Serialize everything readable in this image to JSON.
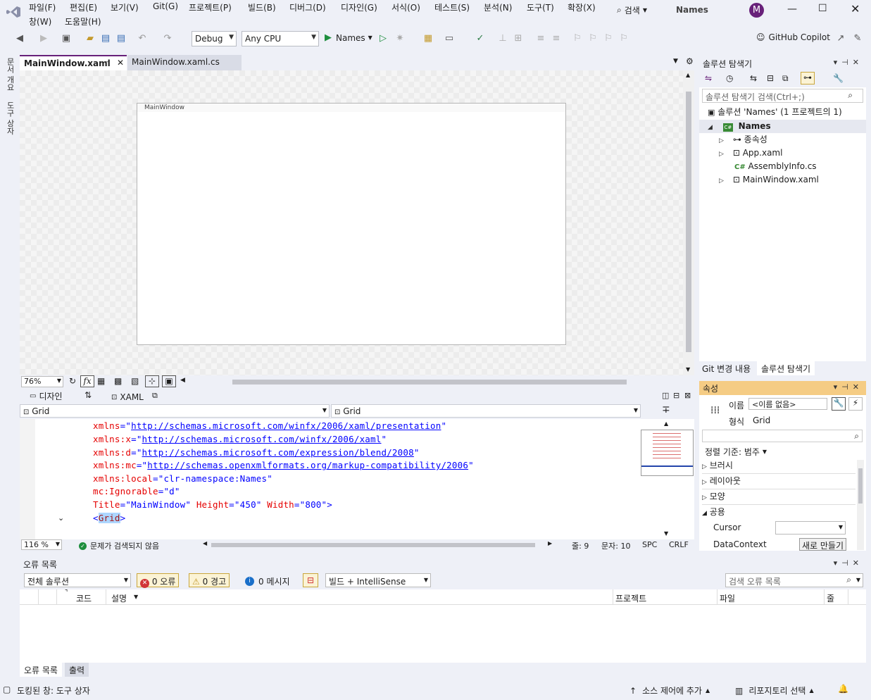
{
  "menu": {
    "row1": [
      "파일(F)",
      "편집(E)",
      "보기(V)",
      "Git(G)",
      "프로젝트(P)",
      "빌드(B)",
      "디버그(D)",
      "디자인(G)",
      "서식(O)",
      "테스트(S)",
      "분석(N)",
      "도구(T)",
      "확장(X)"
    ],
    "row2": [
      "창(W)",
      "도움말(H)"
    ],
    "search_label": "검색",
    "solution_name": "Names",
    "avatar_letter": "M"
  },
  "toolbar": {
    "config": "Debug",
    "platform": "Any CPU",
    "run_target": "Names",
    "copilot": "GitHub Copilot"
  },
  "leftrail": {
    "item1": "문서 개요",
    "item2": "도구 상자"
  },
  "doctabs": {
    "tab1": "MainWindow.xaml",
    "tab2": "MainWindow.xaml.cs"
  },
  "designer": {
    "window_title": "MainWindow"
  },
  "zoom": {
    "designer_zoom": "76%",
    "fx": "fx"
  },
  "split": {
    "design_tab": "디자인",
    "swap": "⇅",
    "xaml_tab": "XAML"
  },
  "elembar": {
    "left": "Grid",
    "right": "Grid"
  },
  "code": {
    "line1": {
      "attr": "xmlns",
      "url": "http://schemas.microsoft.com/winfx/2006/xaml/presentation"
    },
    "line2": {
      "attr": "xmlns:x",
      "url": "http://schemas.microsoft.com/winfx/2006/xaml"
    },
    "line3": {
      "attr": "xmlns:d",
      "url": "http://schemas.microsoft.com/expression/blend/2008"
    },
    "line4": {
      "attr": "xmlns:mc",
      "url": "http://schemas.openxmlformats.org/markup-compatibility/2006"
    },
    "line5": {
      "attr": "xmlns:local",
      "val": "clr-namespace:Names"
    },
    "line6": {
      "attr": "mc:Ignorable",
      "val": "d"
    },
    "line7": {
      "a1": "Title",
      "v1": "MainWindow",
      "a2": "Height",
      "v2": "450",
      "a3": "Width",
      "v3": "800"
    },
    "line8": {
      "tag": "Grid"
    }
  },
  "editor_status": {
    "zoom": "116 %",
    "issues": "문제가 검색되지 않음",
    "line": "줄: 9",
    "col": "문자: 10",
    "spc": "SPC",
    "crlf": "CRLF"
  },
  "solution": {
    "title": "솔루션 탐색기",
    "search_placeholder": "솔루션 탐색기 검색(Ctrl+;)",
    "root": "솔루션 'Names' (1 프로젝트의 1)",
    "project": "Names",
    "items": [
      "종속성",
      "App.xaml",
      "AssemblyInfo.cs",
      "MainWindow.xaml"
    ],
    "tab_git": "Git 변경 내용",
    "tab_sol": "솔루션 탐색기"
  },
  "props": {
    "title": "속성",
    "name_label": "이름",
    "name_value": "<이름 없음>",
    "type_label": "형식",
    "type_value": "Grid",
    "sort": "정렬 기준: 범주",
    "categories": [
      "브러시",
      "레이아웃",
      "모양",
      "공용"
    ],
    "cursor_label": "Cursor",
    "datacontext_label": "DataContext",
    "new_button": "새로 만들기"
  },
  "errors": {
    "title": "오류 목록",
    "scope": "전체 솔루션",
    "errors": "0 오류",
    "warnings": "0 경고",
    "messages": "0 메시지",
    "build": "빌드 + IntelliSense",
    "search_placeholder": "검색 오류 목록",
    "col_code": "코드",
    "col_desc": "설명",
    "col_project": "프로젝트",
    "col_file": "파일",
    "col_line": "줄",
    "tab_errors": "오류 목록",
    "tab_output": "출력"
  },
  "statusbar": {
    "left": "도킹된 창: 도구 상자",
    "source": "소스 제어에 추가",
    "repo": "리포지토리 선택"
  },
  "colors": {
    "accent": "#68217a",
    "tab_active": "#f5cc84",
    "status_bg": "#eef0f7"
  }
}
